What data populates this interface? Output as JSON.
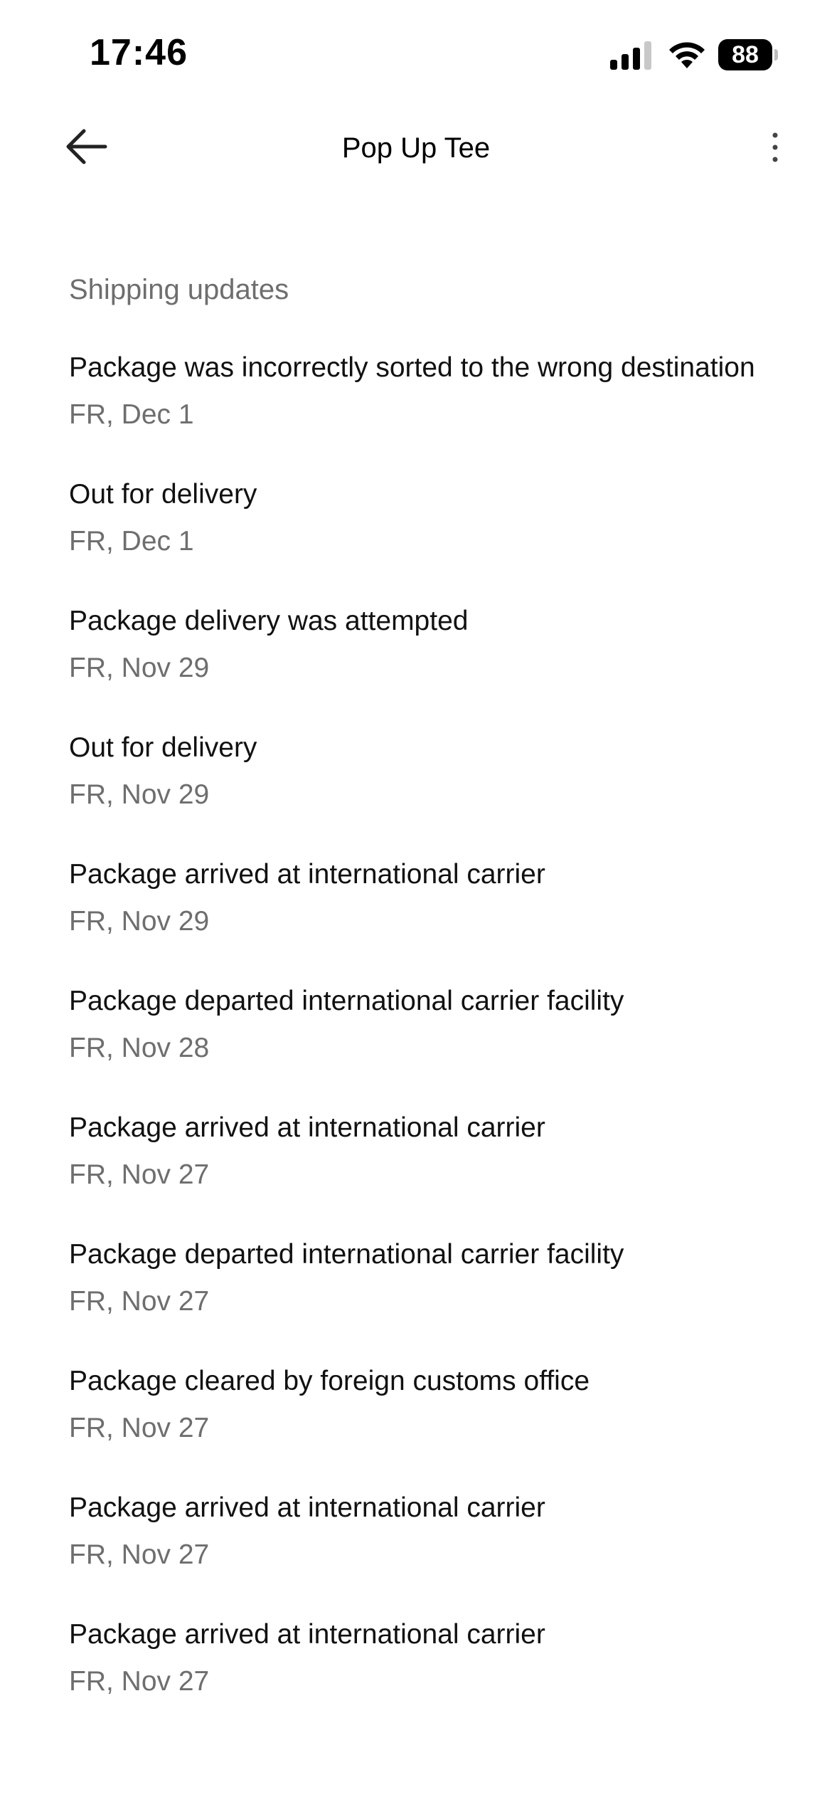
{
  "status_bar": {
    "time": "17:46",
    "battery": "88",
    "icons": [
      "signal-icon",
      "wifi-icon",
      "battery-icon"
    ]
  },
  "header": {
    "title": "Pop Up Tee",
    "back_icon": "arrow-left-icon",
    "more_icon": "more-vertical-icon"
  },
  "section": {
    "label": "Shipping updates"
  },
  "updates": [
    {
      "title": "Package was incorrectly sorted to the wrong destination",
      "date": "FR, Dec 1"
    },
    {
      "title": "Out for delivery",
      "date": "FR, Dec 1"
    },
    {
      "title": "Package delivery was attempted",
      "date": "FR, Nov 29"
    },
    {
      "title": "Out for delivery",
      "date": "FR, Nov 29"
    },
    {
      "title": "Package arrived at international carrier",
      "date": "FR, Nov 29"
    },
    {
      "title": "Package departed international carrier facility",
      "date": "FR, Nov 28"
    },
    {
      "title": "Package arrived at international carrier",
      "date": "FR, Nov 27"
    },
    {
      "title": "Package departed international carrier facility",
      "date": "FR, Nov 27"
    },
    {
      "title": "Package cleared by foreign customs office",
      "date": "FR, Nov 27"
    },
    {
      "title": "Package arrived at international carrier",
      "date": "FR, Nov 27"
    },
    {
      "title": "Package arrived at international carrier",
      "date": "FR, Nov 27"
    }
  ],
  "colors": {
    "text_primary": "#111111",
    "text_secondary": "#6e6e6e",
    "background": "#ffffff"
  }
}
